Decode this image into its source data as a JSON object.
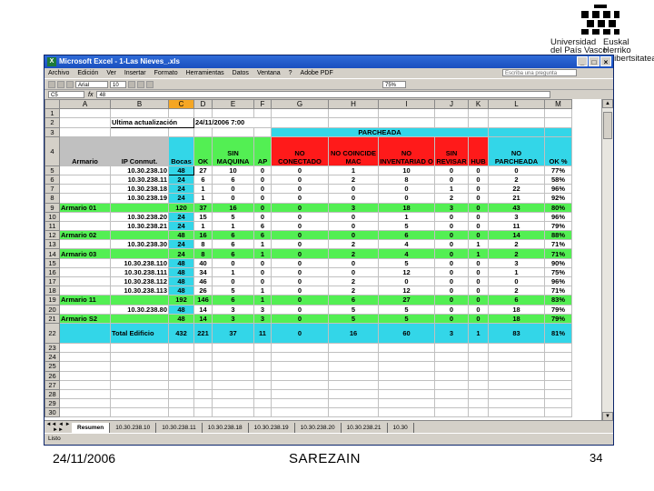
{
  "slide": {
    "footer_date": "24/11/2006",
    "footer_center": "SAREZAIN",
    "page_number": "34",
    "logo": {
      "left_line1": "Universidad",
      "left_line2": "del País Vasco",
      "right_line1": "Euskal Herriko",
      "right_line2": "Unibertsitatea"
    }
  },
  "excel": {
    "title": "Microsoft Excel - 1-Las Nieves_.xls",
    "menu": [
      "Archivo",
      "Edición",
      "Ver",
      "Insertar",
      "Formato",
      "Herramientas",
      "Datos",
      "Ventana",
      "?",
      "Adobe PDF"
    ],
    "help_placeholder": "Escriba una pregunta",
    "font_name": "Arial",
    "font_size": "10",
    "zoom": "75%",
    "name_box": "C5",
    "fx_label": "fx",
    "formula": "48",
    "columns": [
      "A",
      "B",
      "C",
      "D",
      "E",
      "F",
      "G",
      "H",
      "I",
      "J",
      "K",
      "L",
      "M"
    ],
    "selected_column": "C",
    "row_numbers": [
      "1",
      "2",
      "3",
      "4",
      "5",
      "6",
      "7",
      "8",
      "9",
      "10",
      "11",
      "12",
      "13",
      "14",
      "15",
      "16",
      "17",
      "18",
      "19",
      "20",
      "21",
      "22",
      "23",
      "24",
      "25",
      "26",
      "27",
      "28",
      "29",
      "30"
    ],
    "update_label": "Ultima actualización",
    "update_date": "24/11/2006 7:00",
    "parcheada": "PARCHEADA",
    "headers": {
      "armario": "Armario",
      "ip": "IP Conmut.",
      "bocas": "Bocas",
      "ok": "OK",
      "sin_maquina": "SIN MAQUINA",
      "ap": "AP",
      "no_conectado": "NO CONECTADO",
      "no_coincide_mac": "NO COINCIDE MAC",
      "no_inventariado": "NO INVENTARIAD O",
      "sin_revisar": "SIN REVISAR",
      "hub": "HUB",
      "no_parcheada": "NO PARCHEADA",
      "ok_pct": "OK %"
    },
    "rows": [
      {
        "armario": "",
        "ip": "10.30.238.10",
        "bocas": "48",
        "ok": "27",
        "sinmaq": "10",
        "ap": "0",
        "noconec": "0",
        "nomac": "1",
        "noinv": "10",
        "sinrev": "0",
        "hub": "0",
        "nopar": "0",
        "okpct": "77%",
        "type": "switch"
      },
      {
        "armario": "",
        "ip": "10.30.238.11",
        "bocas": "24",
        "ok": "6",
        "sinmaq": "6",
        "ap": "0",
        "noconec": "0",
        "nomac": "2",
        "noinv": "8",
        "sinrev": "0",
        "hub": "0",
        "nopar": "2",
        "okpct": "58%",
        "type": "switch"
      },
      {
        "armario": "",
        "ip": "10.30.238.18",
        "bocas": "24",
        "ok": "1",
        "sinmaq": "0",
        "ap": "0",
        "noconec": "0",
        "nomac": "0",
        "noinv": "0",
        "sinrev": "1",
        "hub": "0",
        "nopar": "22",
        "okpct": "96%",
        "type": "switch"
      },
      {
        "armario": "",
        "ip": "10.30.238.19",
        "bocas": "24",
        "ok": "1",
        "sinmaq": "0",
        "ap": "0",
        "noconec": "0",
        "nomac": "0",
        "noinv": "0",
        "sinrev": "2",
        "hub": "0",
        "nopar": "21",
        "okpct": "92%",
        "type": "switch"
      },
      {
        "armario": "Armario 01",
        "ip": "",
        "bocas": "120",
        "ok": "37",
        "sinmaq": "16",
        "ap": "0",
        "noconec": "0",
        "nomac": "3",
        "noinv": "18",
        "sinrev": "3",
        "hub": "0",
        "nopar": "43",
        "okpct": "80%",
        "type": "total"
      },
      {
        "armario": "",
        "ip": "10.30.238.20",
        "bocas": "24",
        "ok": "15",
        "sinmaq": "5",
        "ap": "0",
        "noconec": "0",
        "nomac": "0",
        "noinv": "1",
        "sinrev": "0",
        "hub": "0",
        "nopar": "3",
        "okpct": "96%",
        "type": "switch"
      },
      {
        "armario": "",
        "ip": "10.30.238.21",
        "bocas": "24",
        "ok": "1",
        "sinmaq": "1",
        "ap": "6",
        "noconec": "0",
        "nomac": "0",
        "noinv": "5",
        "sinrev": "0",
        "hub": "0",
        "nopar": "11",
        "okpct": "79%",
        "type": "switch"
      },
      {
        "armario": "Armario 02",
        "ip": "",
        "bocas": "48",
        "ok": "16",
        "sinmaq": "6",
        "ap": "6",
        "noconec": "0",
        "nomac": "0",
        "noinv": "6",
        "sinrev": "0",
        "hub": "0",
        "nopar": "14",
        "okpct": "88%",
        "type": "total"
      },
      {
        "armario": "",
        "ip": "10.30.238.30",
        "bocas": "24",
        "ok": "8",
        "sinmaq": "6",
        "ap": "1",
        "noconec": "0",
        "nomac": "2",
        "noinv": "4",
        "sinrev": "0",
        "hub": "1",
        "nopar": "2",
        "okpct": "71%",
        "type": "switch"
      },
      {
        "armario": "Armario 03",
        "ip": "",
        "bocas": "24",
        "ok": "8",
        "sinmaq": "6",
        "ap": "1",
        "noconec": "0",
        "nomac": "2",
        "noinv": "4",
        "sinrev": "0",
        "hub": "1",
        "nopar": "2",
        "okpct": "71%",
        "type": "total"
      },
      {
        "armario": "",
        "ip": "10.30.238.110",
        "bocas": "48",
        "ok": "40",
        "sinmaq": "0",
        "ap": "0",
        "noconec": "0",
        "nomac": "0",
        "noinv": "5",
        "sinrev": "0",
        "hub": "0",
        "nopar": "3",
        "okpct": "90%",
        "type": "switch"
      },
      {
        "armario": "",
        "ip": "10.30.238.111",
        "bocas": "48",
        "ok": "34",
        "sinmaq": "1",
        "ap": "0",
        "noconec": "0",
        "nomac": "0",
        "noinv": "12",
        "sinrev": "0",
        "hub": "0",
        "nopar": "1",
        "okpct": "75%",
        "type": "switch"
      },
      {
        "armario": "",
        "ip": "10.30.238.112",
        "bocas": "48",
        "ok": "46",
        "sinmaq": "0",
        "ap": "0",
        "noconec": "0",
        "nomac": "2",
        "noinv": "0",
        "sinrev": "0",
        "hub": "0",
        "nopar": "0",
        "okpct": "96%",
        "type": "switch"
      },
      {
        "armario": "",
        "ip": "10.30.238.113",
        "bocas": "48",
        "ok": "26",
        "sinmaq": "5",
        "ap": "1",
        "noconec": "0",
        "nomac": "2",
        "noinv": "12",
        "sinrev": "0",
        "hub": "0",
        "nopar": "2",
        "okpct": "71%",
        "type": "switch"
      },
      {
        "armario": "Armario 11",
        "ip": "",
        "bocas": "192",
        "ok": "146",
        "sinmaq": "6",
        "ap": "1",
        "noconec": "0",
        "nomac": "6",
        "noinv": "27",
        "sinrev": "0",
        "hub": "0",
        "nopar": "6",
        "okpct": "83%",
        "type": "total"
      },
      {
        "armario": "",
        "ip": "10.30.238.80",
        "bocas": "48",
        "ok": "14",
        "sinmaq": "3",
        "ap": "3",
        "noconec": "0",
        "nomac": "5",
        "noinv": "5",
        "sinrev": "0",
        "hub": "0",
        "nopar": "18",
        "okpct": "79%",
        "type": "switch"
      },
      {
        "armario": "Armario S2",
        "ip": "",
        "bocas": "48",
        "ok": "14",
        "sinmaq": "3",
        "ap": "3",
        "noconec": "0",
        "nomac": "5",
        "noinv": "5",
        "sinrev": "0",
        "hub": "0",
        "nopar": "18",
        "okpct": "79%",
        "type": "total"
      }
    ],
    "grand_total": {
      "label": "Total Edificio",
      "bocas": "432",
      "ok": "221",
      "sinmaq": "37",
      "ap": "11",
      "noconec": "0",
      "nomac": "16",
      "noinv": "60",
      "sinrev": "3",
      "hub": "1",
      "nopar": "83",
      "okpct": "81%"
    },
    "sheet_tabs": [
      "Resumen",
      "10.30.238.10",
      "10.30.238.11",
      "10.30.238.18",
      "10.30.238.19",
      "10.30.238.20",
      "10.30.238.21",
      "10.30"
    ],
    "active_tab": "Resumen",
    "status": "Listo"
  }
}
